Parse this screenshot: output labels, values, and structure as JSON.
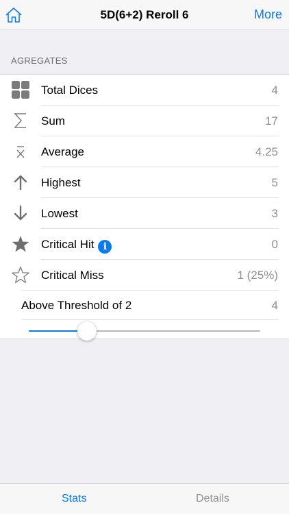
{
  "nav": {
    "title": "5D(6+2) Reroll 6",
    "more_label": "More",
    "home_icon": "home-icon",
    "accent": "#0a7af0"
  },
  "section": {
    "header": "AGREGATES"
  },
  "rows": [
    {
      "icon": "grid-icon",
      "label": "Total Dices",
      "value": "4"
    },
    {
      "icon": "sigma-icon",
      "label": "Sum",
      "value": "17"
    },
    {
      "icon": "x-bar-icon",
      "label": "Average",
      "value": "4.25"
    },
    {
      "icon": "arrow-up-icon",
      "label": "Highest",
      "value": "5"
    },
    {
      "icon": "arrow-down-icon",
      "label": "Lowest",
      "value": "3"
    },
    {
      "icon": "star-filled-icon",
      "label": "Critical Hit",
      "value": "0"
    },
    {
      "icon": "star-outline-icon",
      "label": "Critical Miss",
      "value": "1 (25%)"
    }
  ],
  "threshold": {
    "label": "Above Threshold of 2",
    "value": "4",
    "slider_fraction": 0.25
  },
  "tabs": [
    {
      "label": "Stats",
      "active": true
    },
    {
      "label": "Details",
      "active": false
    }
  ]
}
